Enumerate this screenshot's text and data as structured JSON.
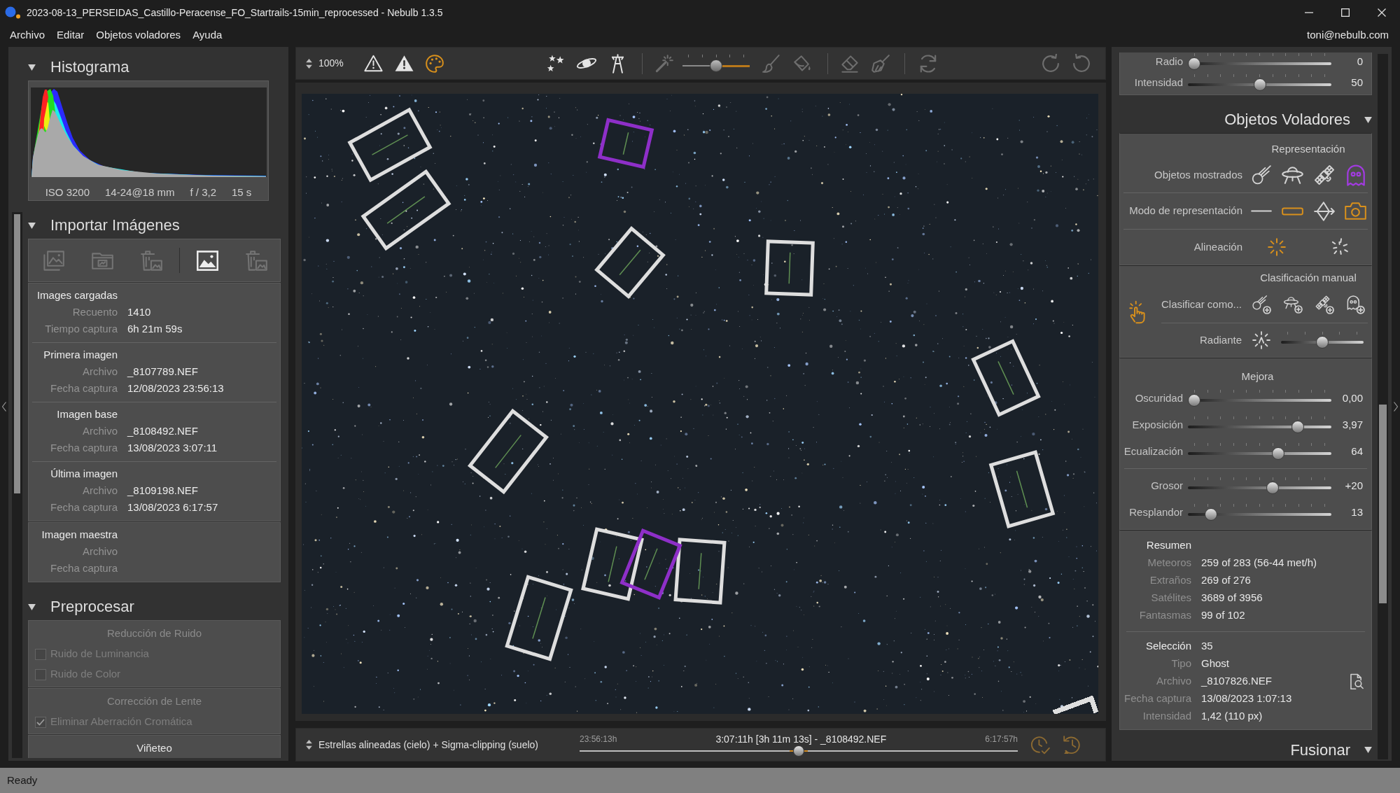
{
  "window": {
    "title": "2023-08-13_PERSEIDAS_Castillo-Peracense_FO_Startrails-15min_reprocessed - Nebulb 1.3.5",
    "menu": [
      "Archivo",
      "Editar",
      "Objetos voladores",
      "Ayuda"
    ],
    "user": "toni@nebulb.com"
  },
  "left_panel": {
    "histogram": {
      "title": "Histograma",
      "expanded": true,
      "exif": [
        "ISO 3200",
        "14-24@18 mm",
        "f / 3,2",
        "15 s"
      ]
    },
    "import": {
      "title": "Importar Imágenes",
      "expanded": true,
      "tool_groups": [
        {
          "tools": [
            {
              "disabled": true
            },
            {
              "disabled": true
            },
            {
              "disabled": true
            }
          ]
        },
        {
          "tools": [
            {
              "disabled": false
            },
            {
              "disabled": true
            }
          ]
        }
      ],
      "info_cards": [
        {
          "groups": [
            {
              "title": "Images cargadas",
              "rows": [
                {
                  "label": "Recuento",
                  "value": "1410"
                },
                {
                  "label": "Tiempo captura",
                  "value": "6h 21m 59s"
                }
              ]
            },
            {
              "title": "Primera imagen",
              "rows": [
                {
                  "label": "Archivo",
                  "value": "_8107789.NEF"
                },
                {
                  "label": "Fecha captura",
                  "value": "12/08/2023 23:56:13"
                }
              ]
            },
            {
              "title": "Imagen base",
              "rows": [
                {
                  "label": "Archivo",
                  "value": "_8108492.NEF"
                },
                {
                  "label": "Fecha captura",
                  "value": "13/08/2023 3:07:11"
                }
              ]
            },
            {
              "title": "Última imagen",
              "rows": [
                {
                  "label": "Archivo",
                  "value": "_8109198.NEF"
                },
                {
                  "label": "Fecha captura",
                  "value": "13/08/2023 6:17:57"
                }
              ]
            }
          ]
        },
        {
          "groups": [
            {
              "title": "Imagen maestra",
              "rows": [
                {
                  "label": "Archivo"
                },
                {
                  "label": "Fecha captura"
                }
              ]
            }
          ]
        }
      ]
    },
    "preprocess": {
      "title": "Preprocesar",
      "expanded": true,
      "sections": [
        {
          "title": "Reducción de Ruido",
          "disabled": true,
          "options": [
            {
              "label": "Ruido de Luminancia",
              "checked": false
            },
            {
              "label": "Ruido de Color",
              "checked": false
            }
          ]
        },
        {
          "title": "Corrección de Lente",
          "disabled": true,
          "options": [
            {
              "label": "Eliminar Aberración Cromática",
              "checked": true
            }
          ]
        },
        {
          "title": "Viñeteo",
          "disabled": false
        }
      ]
    }
  },
  "toolbar": {
    "zoom": "100%",
    "groups": [
      {
        "tools": [
          {
            "kind": "button",
            "active": false,
            "disabled": false
          },
          {
            "kind": "button",
            "active": false,
            "disabled": false
          },
          {
            "kind": "button",
            "active": true,
            "disabled": false
          }
        ]
      },
      {
        "tools": [
          {
            "kind": "button",
            "active": false,
            "disabled": false
          },
          {
            "kind": "button",
            "active": false,
            "disabled": false
          },
          {
            "kind": "button",
            "active": false,
            "disabled": false
          }
        ]
      },
      {
        "tools": [
          {
            "kind": "button",
            "active": false,
            "disabled": true
          },
          {
            "kind": "slider",
            "level": 0.5
          },
          {
            "kind": "button",
            "active": false,
            "disabled": true
          },
          {
            "kind": "button",
            "active": false,
            "disabled": true
          }
        ]
      },
      {
        "tools": [
          {
            "kind": "button",
            "active": false,
            "disabled": true
          },
          {
            "kind": "button",
            "active": false,
            "disabled": true
          }
        ]
      },
      {
        "tools": [
          {
            "kind": "button",
            "active": false,
            "disabled": true
          }
        ]
      },
      {
        "tools": [
          {
            "kind": "button",
            "active": false,
            "disabled": true
          },
          {
            "kind": "button",
            "active": false,
            "disabled": true
          }
        ]
      }
    ]
  },
  "image_view": {
    "detections": [
      {
        "color": "#dedede"
      },
      {
        "color": "#dedede"
      },
      {
        "color": "#8e2fc8"
      },
      {
        "color": "#dedede"
      },
      {
        "color": "#dedede"
      },
      {
        "color": "#dedede"
      },
      {
        "color": "#dedede"
      },
      {
        "color": "#dedede"
      },
      {
        "color": "#dedede"
      },
      {
        "color": "#dedede"
      },
      {
        "color": "#8e2fc8"
      },
      {
        "color": "#dedede"
      },
      {
        "color": "#dedede"
      }
    ]
  },
  "bottom_bar": {
    "stack_mode": "Estrellas alineadas (cielo) + Sigma-clipping (suelo)",
    "timeline": {
      "start": "23:56:13h",
      "current": "3:07:11h [3h 11m 13s] - _8108492.NEF",
      "end": "6:17:57h",
      "level": 0.5
    }
  },
  "right_panel": {
    "top_card": {
      "sliders": [
        {
          "label": "Radio",
          "level": 0,
          "reading": "0"
        },
        {
          "label": "Intensidad",
          "level": 0.5,
          "reading": "50"
        }
      ]
    },
    "flying_objects": {
      "title": "Objetos Voladores",
      "expanded": true,
      "representation": {
        "title": "Representación",
        "rows": [
          {
            "label": "Objetos mostrados",
            "options": [
              {
                "on": false
              },
              {
                "on": false
              },
              {
                "on": false
              },
              {
                "on": true
              }
            ]
          },
          {
            "label": "Modo de representación",
            "options": [
              {
                "on": false
              },
              {
                "on": true
              },
              {
                "on": false
              },
              {
                "on": true
              }
            ]
          },
          {
            "label": "Alineación",
            "options": [
              {
                "on": true
              },
              {
                "on": false
              }
            ]
          }
        ]
      },
      "manual_classification": {
        "title": "Clasificación manual",
        "active": true,
        "classify_label": "Clasificar como...",
        "radiant": {
          "label": "Radiante",
          "level": 0.5
        }
      },
      "enhancement": {
        "title": "Mejora",
        "groups": [
          {
            "sliders": [
              {
                "label": "Oscuridad",
                "level": 0,
                "reading": "0,00"
              },
              {
                "label": "Exposición",
                "level": 0.79,
                "reading": "3,97"
              },
              {
                "label": "Ecualización",
                "level": 0.64,
                "reading": "64"
              }
            ]
          },
          {
            "sliders": [
              {
                "label": "Grosor",
                "level": 0.6,
                "reading": "+20"
              },
              {
                "label": "Resplandor",
                "level": 0.13,
                "reading": "13"
              }
            ]
          }
        ]
      },
      "summary": {
        "title": "Resumen",
        "rows": [
          {
            "label": "Meteoros",
            "value": "259 of 283 (56-44 met/h)"
          },
          {
            "label": "Extraños",
            "value": "269 of 276"
          },
          {
            "label": "Satélites",
            "value": "3689 of 3956"
          },
          {
            "label": "Fantasmas",
            "value": "99 of 102"
          }
        ]
      },
      "selection": {
        "label": "Selección",
        "value": "35",
        "rows": [
          {
            "kind": "text",
            "label": "Tipo",
            "value": "Ghost"
          },
          {
            "kind": "file",
            "label": "Archivo",
            "value": "_8107826.NEF"
          },
          {
            "kind": "text",
            "label": "Fecha captura",
            "value": "13/08/2023 1:07:13"
          },
          {
            "kind": "text",
            "label": "Intensidad",
            "value": "1,42 (110 px)"
          }
        ]
      }
    },
    "merge": {
      "title": "Fusionar",
      "expanded": true
    }
  },
  "status_bar": {
    "text": "Ready"
  }
}
